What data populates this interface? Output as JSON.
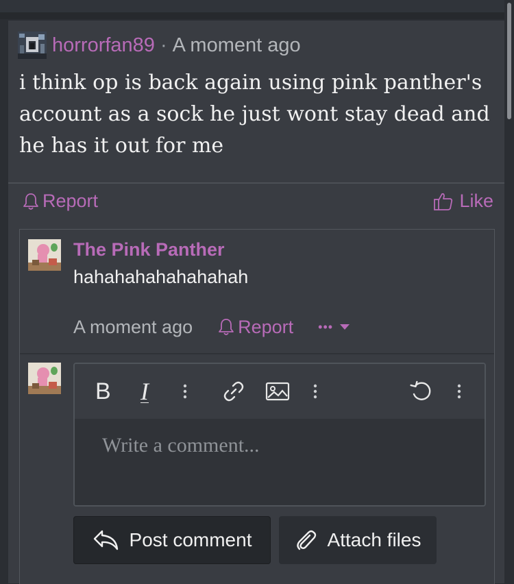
{
  "comment": {
    "username": "horrorfan89",
    "separator": "·",
    "time": "A moment ago",
    "body": "i think op is back again using pink panther's account as a sock he just wont stay dead and he has it out for me",
    "report_label": "Report",
    "like_label": "Like"
  },
  "reply": {
    "username": "The Pink Panther",
    "body": "hahahahahahahahah",
    "time": "A moment ago",
    "report_label": "Report",
    "more_label": "•••"
  },
  "editor": {
    "placeholder": "Write a comment...",
    "bold_label": "B",
    "italic_label": "I"
  },
  "actions": {
    "post_label": "Post comment",
    "attach_label": "Attach files"
  },
  "colors": {
    "accent": "#b86bb8",
    "background": "#393c42",
    "text": "#f1f1f1"
  }
}
